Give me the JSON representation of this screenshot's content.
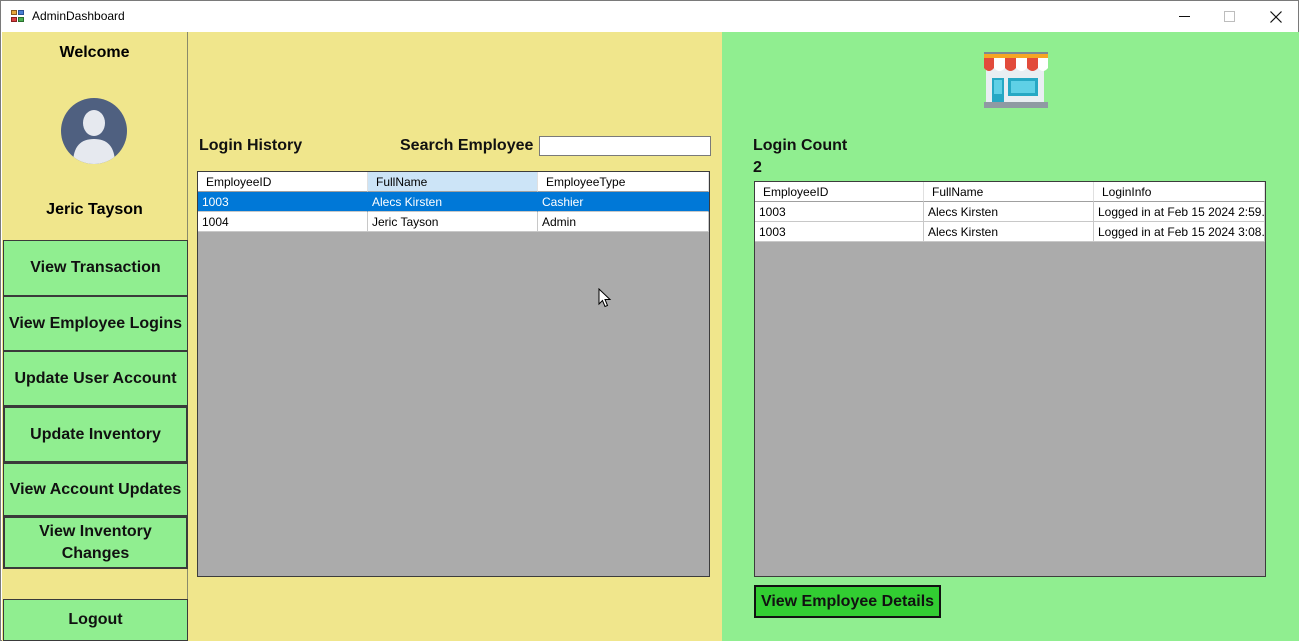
{
  "window": {
    "title": "AdminDashboard",
    "controls": {
      "minimize": "minimize-icon",
      "maximize": "maximize-icon",
      "close": "close-icon"
    }
  },
  "sidebar": {
    "welcome": "Welcome",
    "user_name": "Jeric Tayson",
    "buttons": [
      "View Transaction",
      "View Employee Logins",
      "Update User Account",
      "Update Inventory",
      "View Account Updates",
      "View Inventory Changes"
    ],
    "logout": "Logout"
  },
  "login_history": {
    "title": "Login History",
    "search_label": "Search Employee",
    "search_value": "",
    "columns": [
      "EmployeeID",
      "FullName",
      "EmployeeType"
    ],
    "sorted_column": "FullName",
    "selected_row": 0,
    "rows": [
      [
        "1003",
        "Alecs Kirsten",
        "Cashier"
      ],
      [
        "1004",
        "Jeric Tayson",
        "Admin"
      ]
    ]
  },
  "login_count": {
    "title": "Login Count",
    "count": "2",
    "columns": [
      "EmployeeID",
      "FullName",
      "LoginInfo"
    ],
    "rows": [
      [
        "1003",
        "Alecs Kirsten",
        "Logged in at Feb 15 2024  2:59..."
      ],
      [
        "1003",
        "Alecs Kirsten",
        "Logged in at Feb 15 2024  3:08..."
      ]
    ],
    "details_button": "View Employee Details"
  },
  "icons": {
    "store": "store-icon",
    "user": "user-avatar-icon"
  },
  "colors": {
    "khaki_panel": "#f0e68c",
    "green_panel": "#90ee90",
    "selection": "#0078d7",
    "details_button": "#32cd32"
  }
}
